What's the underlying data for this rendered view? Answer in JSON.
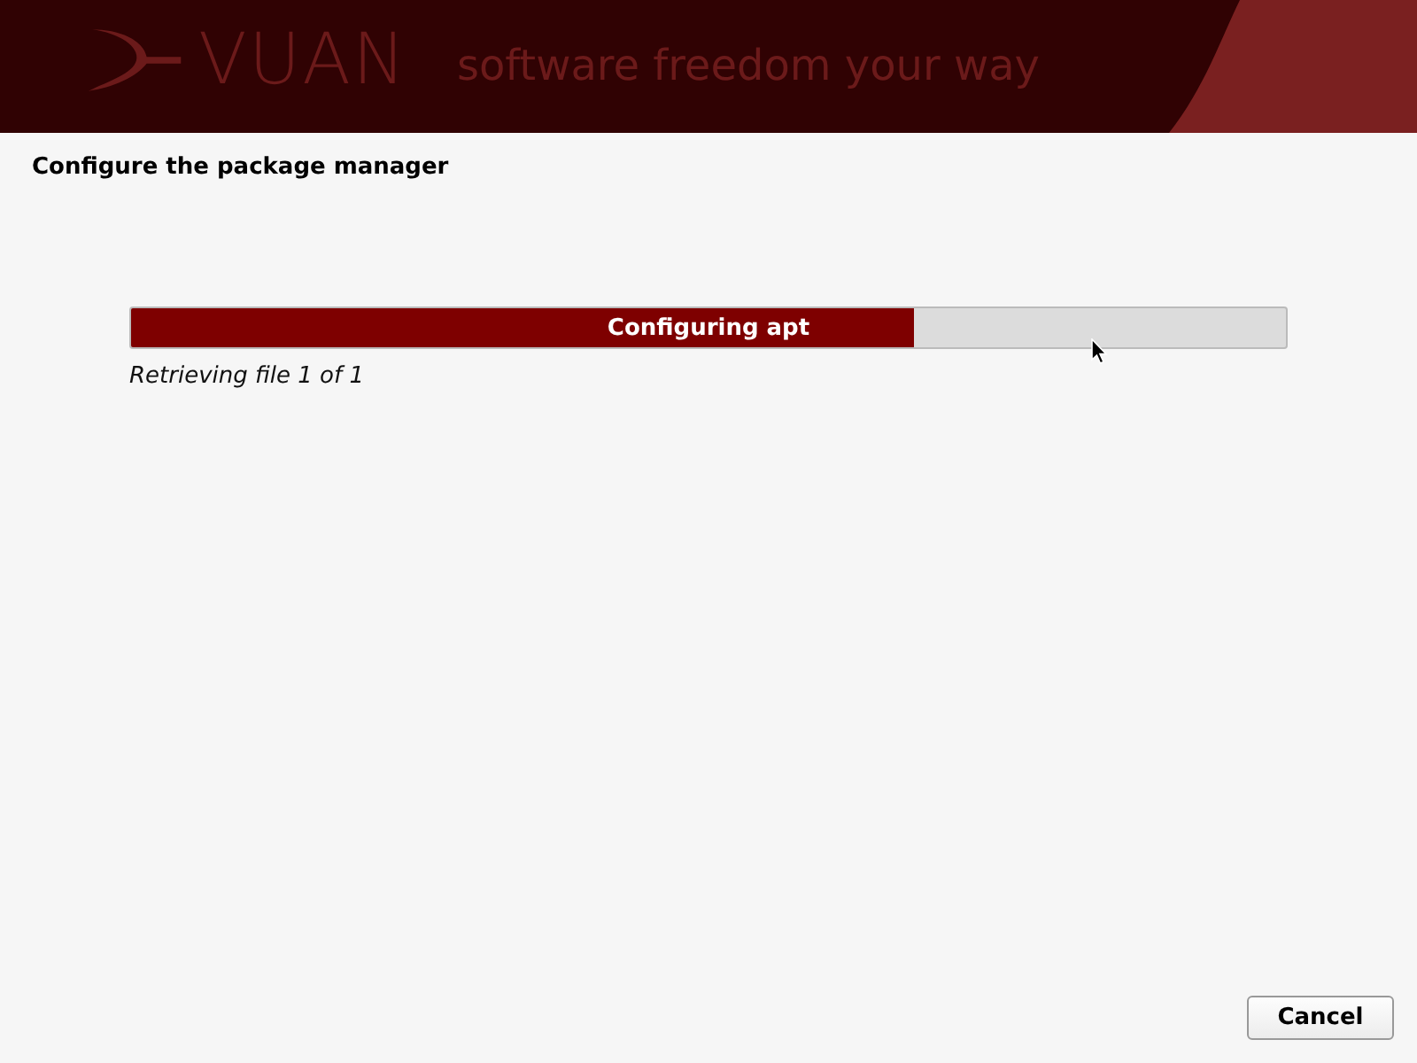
{
  "banner": {
    "logo_text": "VUAN",
    "tagline": "software freedom your way"
  },
  "title": "Configure the package manager",
  "progress": {
    "label": "Configuring apt",
    "level": 0.678,
    "status": "Retrieving file 1 of 1"
  },
  "buttons": [
    {
      "label": "Cancel"
    }
  ]
}
